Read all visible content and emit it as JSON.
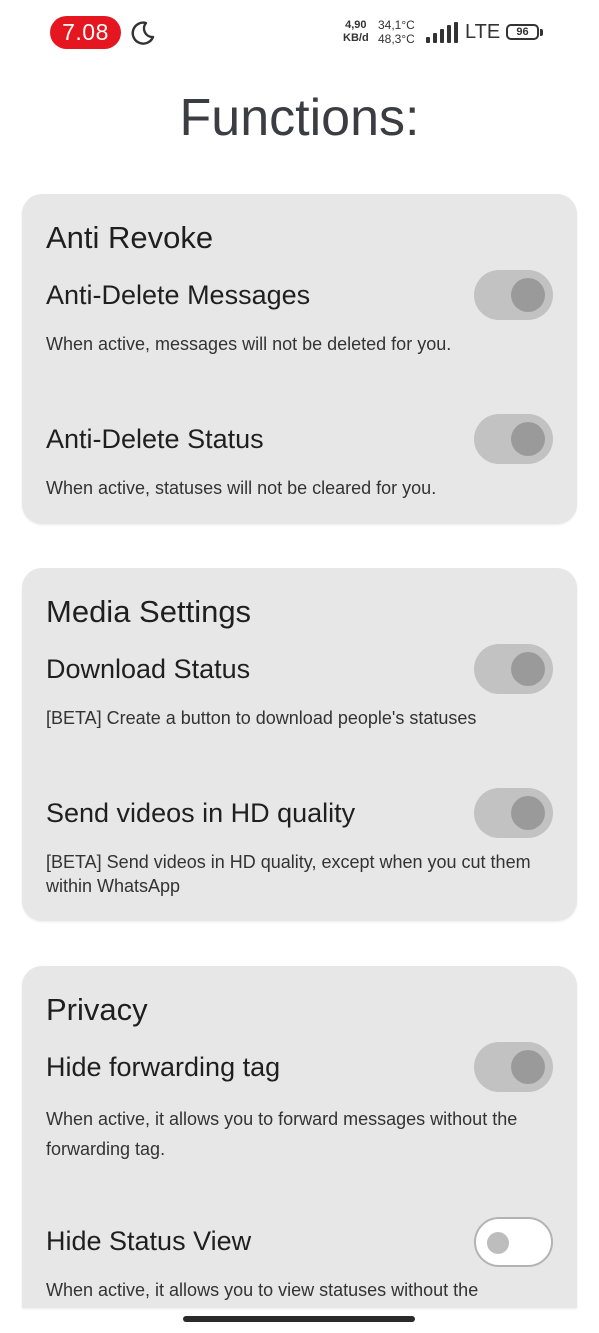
{
  "status_bar": {
    "time": "7.08",
    "net_speed_value": "4,90",
    "net_speed_unit": "KB/d",
    "temp_1": "34,1°C",
    "temp_2": "48,3°C",
    "network": "LTE",
    "battery": "96",
    "icons": [
      "moon-icon",
      "signal-icon"
    ]
  },
  "title": "Functions:",
  "sections": [
    {
      "title": "Anti Revoke",
      "items": [
        {
          "label": "Anti-Delete Messages",
          "desc": "When active, messages will not be deleted for you.",
          "enabled": true
        },
        {
          "label": "Anti-Delete Status",
          "desc": "When active, statuses will not be cleared for you.",
          "enabled": true
        }
      ]
    },
    {
      "title": "Media Settings",
      "items": [
        {
          "label": "Download Status",
          "desc": "[BETA] Create a button to download people's statuses",
          "enabled": true
        },
        {
          "label": "Send videos in HD quality",
          "desc": "[BETA] Send videos in HD quality, except when you cut them within WhatsApp",
          "enabled": true
        }
      ]
    },
    {
      "title": "Privacy",
      "items": [
        {
          "label": "Hide forwarding tag",
          "desc": "When active, it allows you to forward messages without the forwarding tag.",
          "enabled": true
        },
        {
          "label": "Hide Status View",
          "desc": "When active, it allows you to view statuses without the",
          "enabled": false
        }
      ]
    }
  ],
  "colors": {
    "time_pill": "#e5161f",
    "card_bg": "#e7e7e7",
    "toggle_on_track": "#c2c2c2",
    "toggle_on_knob": "#9a9a9a"
  }
}
